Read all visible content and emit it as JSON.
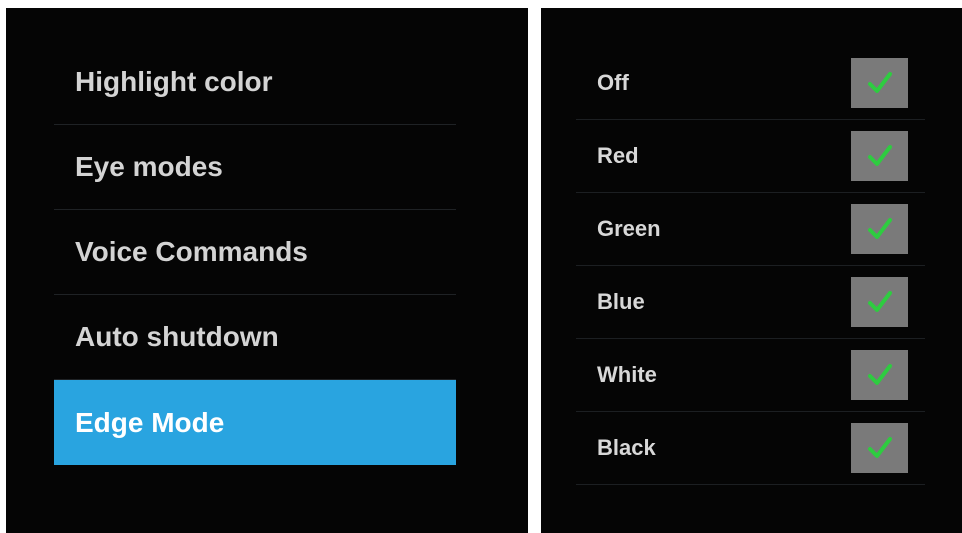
{
  "colors": {
    "panel_background": "#050505",
    "menu_text": "#d4d4d4",
    "selected_background": "#29a4e0",
    "selected_text": "#ffffff",
    "checkbox_background": "#7a7a7a",
    "checkmark": "#2ecc40"
  },
  "menu": {
    "items": [
      {
        "label": "Highlight color",
        "selected": false
      },
      {
        "label": "Eye modes",
        "selected": false
      },
      {
        "label": "Voice Commands",
        "selected": false
      },
      {
        "label": "Auto shutdown",
        "selected": false
      },
      {
        "label": "Edge Mode",
        "selected": true
      }
    ]
  },
  "options": {
    "items": [
      {
        "label": "Off",
        "checked": true,
        "icon": "checkmark-icon"
      },
      {
        "label": "Red",
        "checked": true,
        "icon": "checkmark-icon"
      },
      {
        "label": "Green",
        "checked": true,
        "icon": "checkmark-icon"
      },
      {
        "label": "Blue",
        "checked": true,
        "icon": "checkmark-icon"
      },
      {
        "label": "White",
        "checked": true,
        "icon": "checkmark-icon"
      },
      {
        "label": "Black",
        "checked": true,
        "icon": "checkmark-icon"
      }
    ]
  }
}
